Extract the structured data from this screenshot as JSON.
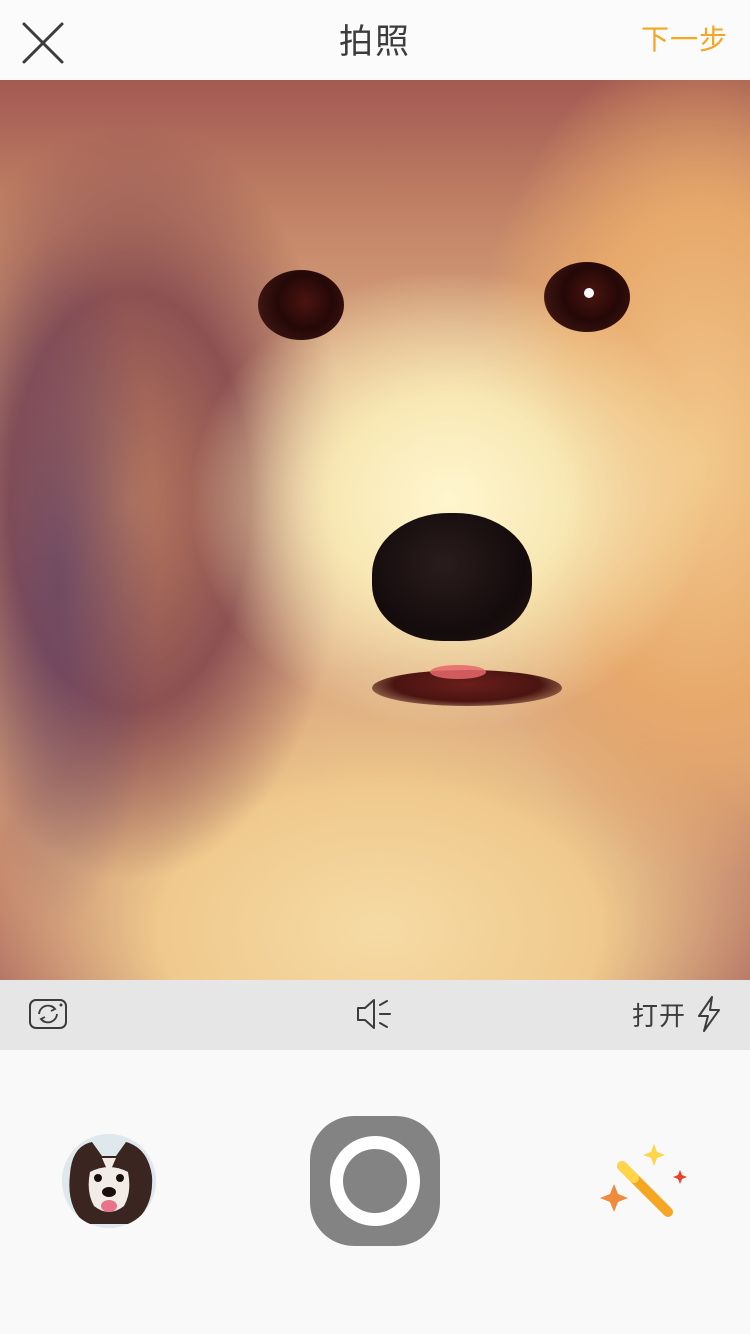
{
  "nav": {
    "title": "拍照",
    "next_label": "下一步",
    "close_icon": "close-icon"
  },
  "toolbar": {
    "flip_icon": "camera-flip-icon",
    "sound_icon": "speaker-mute-icon",
    "flash_label": "打开",
    "flash_icon": "flash-icon"
  },
  "bottom": {
    "album_icon": "album-thumbnail",
    "shutter_icon": "shutter-button",
    "magic_icon": "magic-wand-icon"
  },
  "colors": {
    "accent": "#f5a623",
    "title": "#3c3c3c",
    "toolbar_bg": "#e6e6e6",
    "shutter": "#838383"
  }
}
